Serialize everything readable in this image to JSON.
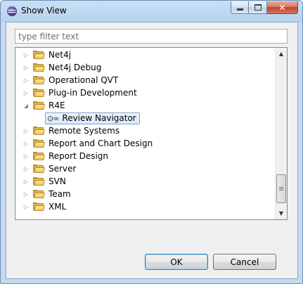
{
  "window": {
    "title": "Show View"
  },
  "filter": {
    "placeholder": "type filter text",
    "value": ""
  },
  "tree": {
    "items": [
      {
        "label": "Net4j",
        "expanded": false
      },
      {
        "label": "Net4j Debug",
        "expanded": false
      },
      {
        "label": "Operational QVT",
        "expanded": false
      },
      {
        "label": "Plug-in Development",
        "expanded": false
      },
      {
        "label": "R4E",
        "expanded": true
      },
      {
        "label": "Review Navigator",
        "child": true,
        "selected": true,
        "icon": "glasses-icon"
      },
      {
        "label": "Remote Systems",
        "expanded": false
      },
      {
        "label": "Report and Chart Design",
        "expanded": false
      },
      {
        "label": "Report Design",
        "expanded": false
      },
      {
        "label": "Server",
        "expanded": false
      },
      {
        "label": "SVN",
        "expanded": false
      },
      {
        "label": "Team",
        "expanded": false
      },
      {
        "label": "XML",
        "expanded": false
      }
    ]
  },
  "buttons": {
    "ok": "OK",
    "cancel": "Cancel"
  },
  "colors": {
    "selection": "#d9e8f9",
    "folder": "#e0b650"
  }
}
